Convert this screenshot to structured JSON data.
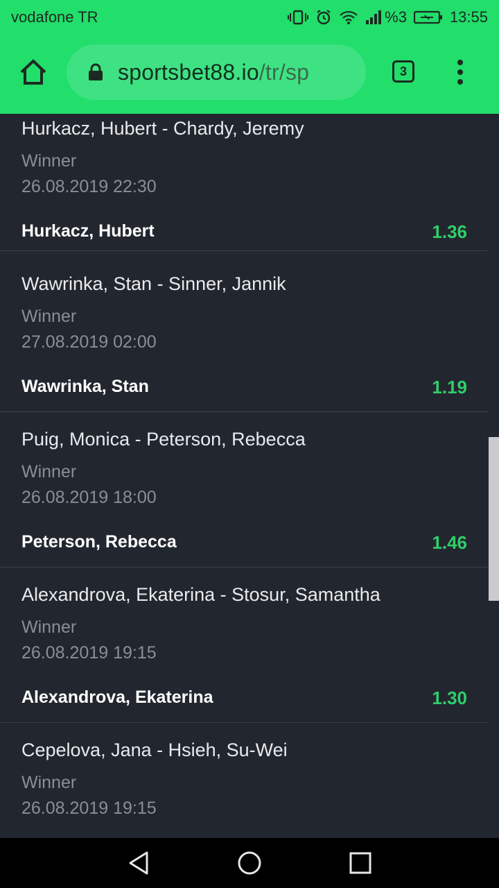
{
  "status_bar": {
    "carrier": "vodafone TR",
    "battery": "%3",
    "time": "13:55"
  },
  "browser": {
    "url_host": "sportsbet88.io",
    "url_path": "/tr/sp",
    "tab_count": "3"
  },
  "events": [
    {
      "title": "Hurkacz, Hubert - Chardy, Jeremy",
      "market": "Winner",
      "date": "26.08.2019 22:30",
      "pick": "Hurkacz, Hubert",
      "odds": "1.36"
    },
    {
      "title": "Wawrinka, Stan - Sinner, Jannik",
      "market": "Winner",
      "date": "27.08.2019 02:00",
      "pick": "Wawrinka, Stan",
      "odds": "1.19"
    },
    {
      "title": "Puig, Monica - Peterson, Rebecca",
      "market": "Winner",
      "date": "26.08.2019 18:00",
      "pick": "Peterson, Rebecca",
      "odds": "1.46"
    },
    {
      "title": "Alexandrova, Ekaterina - Stosur, Samantha",
      "market": "Winner",
      "date": "26.08.2019 19:15",
      "pick": "Alexandrova, Ekaterina",
      "odds": "1.30"
    },
    {
      "title": "Cepelova, Jana - Hsieh, Su-Wei",
      "market": "Winner",
      "date": "26.08.2019 19:15"
    }
  ],
  "colors": {
    "accent": "#22de6a",
    "odds": "#2fce6a",
    "background": "#22272f"
  }
}
